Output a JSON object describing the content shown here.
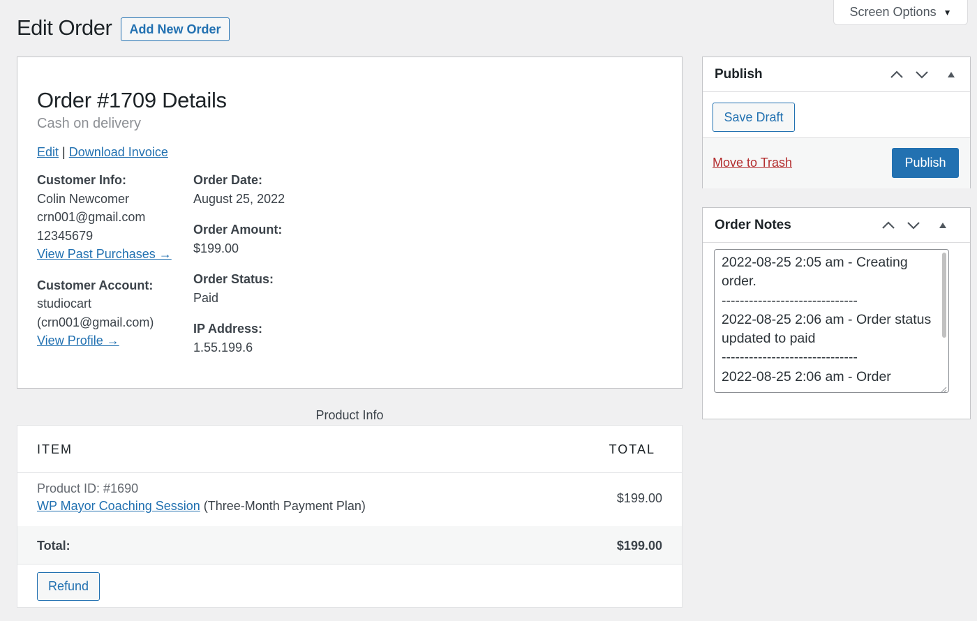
{
  "header": {
    "title": "Edit Order",
    "add_new_label": "Add New Order",
    "screen_options_label": "Screen Options"
  },
  "order": {
    "title": "Order #1709 Details",
    "payment_method": "Cash on delivery",
    "edit_link": "Edit",
    "separator": "|",
    "download_invoice_link": "Download Invoice",
    "customer_info_label": "Customer Info:",
    "customer_name": "Colin Newcomer",
    "customer_email": "crn001@gmail.com",
    "customer_phone": "12345679",
    "view_past_purchases_link": "View Past Purchases →",
    "customer_account_label": "Customer Account:",
    "account_username": "studiocart",
    "account_email": "(crn001@gmail.com)",
    "view_profile_link": "View Profile →",
    "order_date_label": "Order Date:",
    "order_date": "August 25, 2022",
    "order_amount_label": "Order Amount:",
    "order_amount": "$199.00",
    "order_status_label": "Order Status:",
    "order_status": "Paid",
    "ip_address_label": "IP Address:",
    "ip_address": "1.55.199.6"
  },
  "product_info": {
    "caption": "Product Info",
    "columns": [
      "ITEM",
      "TOTAL"
    ],
    "items": [
      {
        "product_id": "Product ID: #1690",
        "name": "WP Mayor Coaching Session",
        "plan": " (Three-Month Payment Plan)",
        "total": "$199.00"
      }
    ],
    "total_label": "Total:",
    "total_value": "$199.00",
    "refund_label": "Refund"
  },
  "publish": {
    "title": "Publish",
    "save_draft_label": "Save Draft",
    "move_to_trash_label": "Move to Trash",
    "publish_label": "Publish"
  },
  "order_notes": {
    "title": "Order Notes",
    "content": "2022-08-25 2:05 am - Creating order.\n------------------------------\n2022-08-25 2:06 am - Order status updated to paid\n------------------------------\n2022-08-25 2:06 am - Order"
  },
  "colors": {
    "link": "#2271b1",
    "primary_button": "#2271b1",
    "trash_link": "#b32d2e",
    "background": "#f0f0f1"
  },
  "icons": [
    "caret-down-icon",
    "chevron-up-icon",
    "chevron-down-icon",
    "toggle-triangle-icon",
    "arrow-right-icon",
    "resize-grip-icon"
  ]
}
